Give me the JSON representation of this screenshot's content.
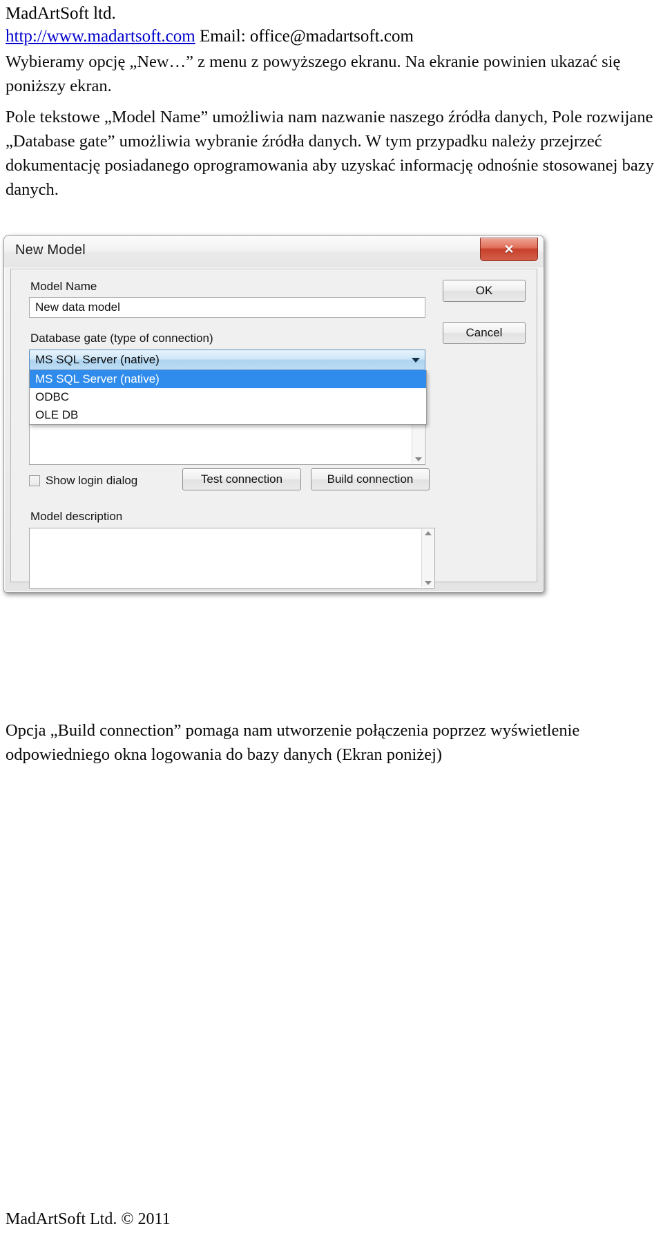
{
  "document": {
    "company": "MadArtSoft ltd.",
    "website": "http://www.madartsoft.com",
    "email_label": "Email: office@madartsoft.com",
    "footer": "MadArtSoft Ltd. © 2011"
  },
  "paragraphs": {
    "intro": "Wybieramy opcję „New…” z menu z powyższego ekranu. Na ekranie powinien ukazać się poniższy ekran.",
    "description": "Pole tekstowe „Model Name” umożliwia nam nazwanie naszego źródła danych, Pole rozwijane „Database gate” umożliwia wybranie źródła danych. W tym przypadku należy przejrzeć dokumentację posiadanego oprogramowania aby uzyskać informację odnośnie stosowanej bazy danych.",
    "build": "Opcja „Build connection” pomaga nam utworzenie połączenia poprzez wyświetlenie odpowiedniego okna logowania do bazy danych (Ekran poniżej)"
  },
  "dialog": {
    "title": "New Model",
    "close_glyph": "✕",
    "model_name": {
      "label": "Model Name",
      "value": "New data model"
    },
    "database_gate": {
      "label": "Database gate (type of connection)",
      "selected": "MS SQL Server (native)",
      "options": [
        "MS SQL Server (native)",
        "ODBC",
        "OLE DB"
      ]
    },
    "connection_string": {
      "value": ""
    },
    "show_login": {
      "label": "Show login dialog",
      "checked": false
    },
    "buttons": {
      "ok": "OK",
      "cancel": "Cancel",
      "test_connection": "Test connection",
      "build_connection": "Build connection"
    },
    "model_description": {
      "label": "Model description",
      "value": ""
    },
    "colors": {
      "close_button": "#c8412c",
      "combo_highlight": "#2f8ced",
      "combo_field": "#aed4f0",
      "window_bg": "#f0f0f0"
    }
  }
}
